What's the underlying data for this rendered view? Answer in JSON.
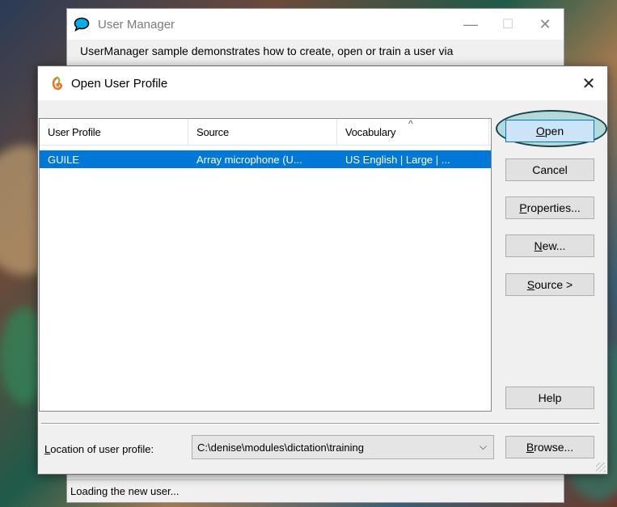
{
  "back_window": {
    "title": "User Manager",
    "description": "UserManager sample demonstrates how to create, open or train a user via",
    "status": "Loading the new user...",
    "controls": {
      "minimize": "—",
      "maximize": "☐",
      "close": "✕"
    }
  },
  "dialog": {
    "title": "Open User Profile",
    "close": "✕",
    "columns": [
      "User Profile",
      "Source",
      "Vocabulary"
    ],
    "sort_indicator": "^",
    "rows": [
      {
        "profile": "GUILE",
        "source": "Array microphone (U...",
        "vocabulary": "US English | Large | ..."
      }
    ],
    "buttons": {
      "open": {
        "first": "O",
        "rest": "pen"
      },
      "cancel": "Cancel",
      "properties": {
        "first": "P",
        "rest": "roperties..."
      },
      "new": {
        "first": "N",
        "rest": "ew..."
      },
      "source": {
        "first": "S",
        "rest": "ource >"
      },
      "help": "Help",
      "browse": {
        "first": "B",
        "rest": "rowse..."
      }
    },
    "location": {
      "label_first": "L",
      "label_rest": "ocation of user profile:",
      "value": "C:\\denise\\modules\\dictation\\training",
      "chevron": "⌵"
    }
  },
  "colors": {
    "selection": "#0078d7",
    "focus_ellipse": "#1b3f48"
  }
}
